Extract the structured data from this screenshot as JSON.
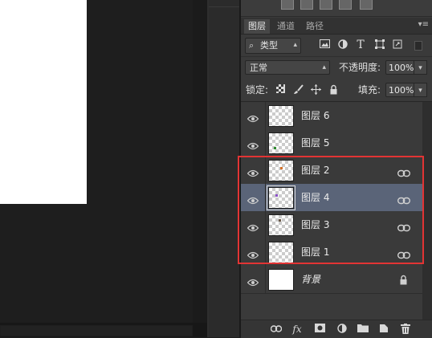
{
  "panel": {
    "tabs": [
      {
        "label": "图层",
        "active": true
      },
      {
        "label": "通道",
        "active": false
      },
      {
        "label": "路径",
        "active": false
      }
    ],
    "menu_icon": "panel-menu-icon"
  },
  "filter": {
    "kind_label": "类型",
    "icons": [
      "pixel-filter-icon",
      "adjustment-filter-icon",
      "type-filter-icon",
      "shape-filter-icon",
      "smart-object-filter-icon"
    ],
    "type_glyph": "T"
  },
  "blend": {
    "mode": "正常",
    "opacity_label": "不透明度:",
    "opacity_value": "100%"
  },
  "lock": {
    "label": "锁定:",
    "fill_label": "填充:",
    "fill_value": "100%"
  },
  "layers": [
    {
      "name": "图层 6",
      "selected": false,
      "linked": false,
      "dot_color": null
    },
    {
      "name": "图层 5",
      "selected": false,
      "linked": false,
      "dot_color": "#2e8b2e"
    },
    {
      "name": "图层 2",
      "selected": false,
      "linked": true,
      "dot_color": "#d4722a"
    },
    {
      "name": "图层 4",
      "selected": true,
      "linked": true,
      "dot_color": "#8a4fc9"
    },
    {
      "name": "图层 3",
      "selected": false,
      "linked": true,
      "dot_color": "#6a5a4a"
    },
    {
      "name": "图层 1",
      "selected": false,
      "linked": true,
      "dot_color": null
    },
    {
      "name": "背景",
      "selected": false,
      "linked": false,
      "locked": true,
      "background": true
    }
  ],
  "colors": {
    "selection_bg": "#5a6478",
    "highlight_border": "#e23434",
    "panel_bg": "#3a3a3a"
  },
  "bottom_icons": [
    "link-layers-icon",
    "fx-icon",
    "add-mask-icon",
    "adjustment-layer-icon",
    "new-group-icon",
    "new-layer-icon",
    "delete-layer-icon"
  ],
  "fx_label": "fx"
}
